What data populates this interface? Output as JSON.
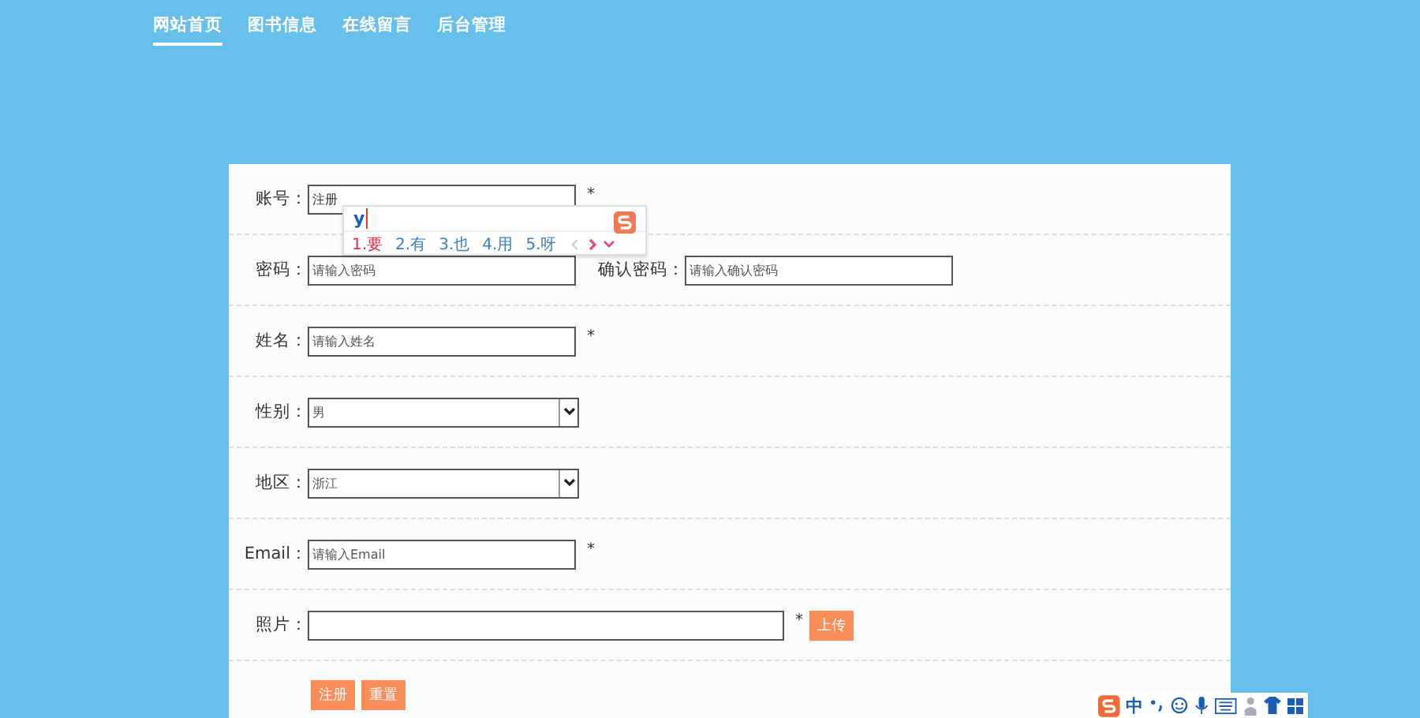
{
  "nav": [
    {
      "label": "网站首页",
      "selected": true
    },
    {
      "label": "图书信息",
      "selected": false
    },
    {
      "label": "在线留言",
      "selected": false
    },
    {
      "label": "后台管理",
      "selected": false
    }
  ],
  "form": {
    "rows": [
      {
        "kind": "input",
        "label": "账号：",
        "value": "注册",
        "required": "*"
      },
      {
        "kind": "pair",
        "label": "密码：",
        "placeholder": "请输入密码",
        "label2": "确认密码：",
        "placeholder2": "请输入确认密码"
      },
      {
        "kind": "input",
        "label": "姓名：",
        "placeholder": "请输入姓名",
        "required": "*"
      },
      {
        "kind": "select",
        "label": "性别：",
        "value": "男"
      },
      {
        "kind": "select",
        "label": "地区：",
        "value": "浙江"
      },
      {
        "kind": "input",
        "label": "Email：",
        "placeholder": "请输入Email",
        "required": "*"
      },
      {
        "kind": "upload",
        "label": "照片：",
        "required": "*",
        "button": "上传"
      }
    ],
    "buttons": [
      "注册",
      "重置"
    ]
  },
  "ime": {
    "composition": "y",
    "candidates": [
      {
        "text": "1.要",
        "selected": true
      },
      {
        "text": "2.有",
        "selected": false
      },
      {
        "text": "3.也",
        "selected": false
      },
      {
        "text": "4.用",
        "selected": false
      },
      {
        "text": "5.呀",
        "selected": false
      }
    ]
  },
  "ime_toolbar": {
    "mode": "中"
  }
}
